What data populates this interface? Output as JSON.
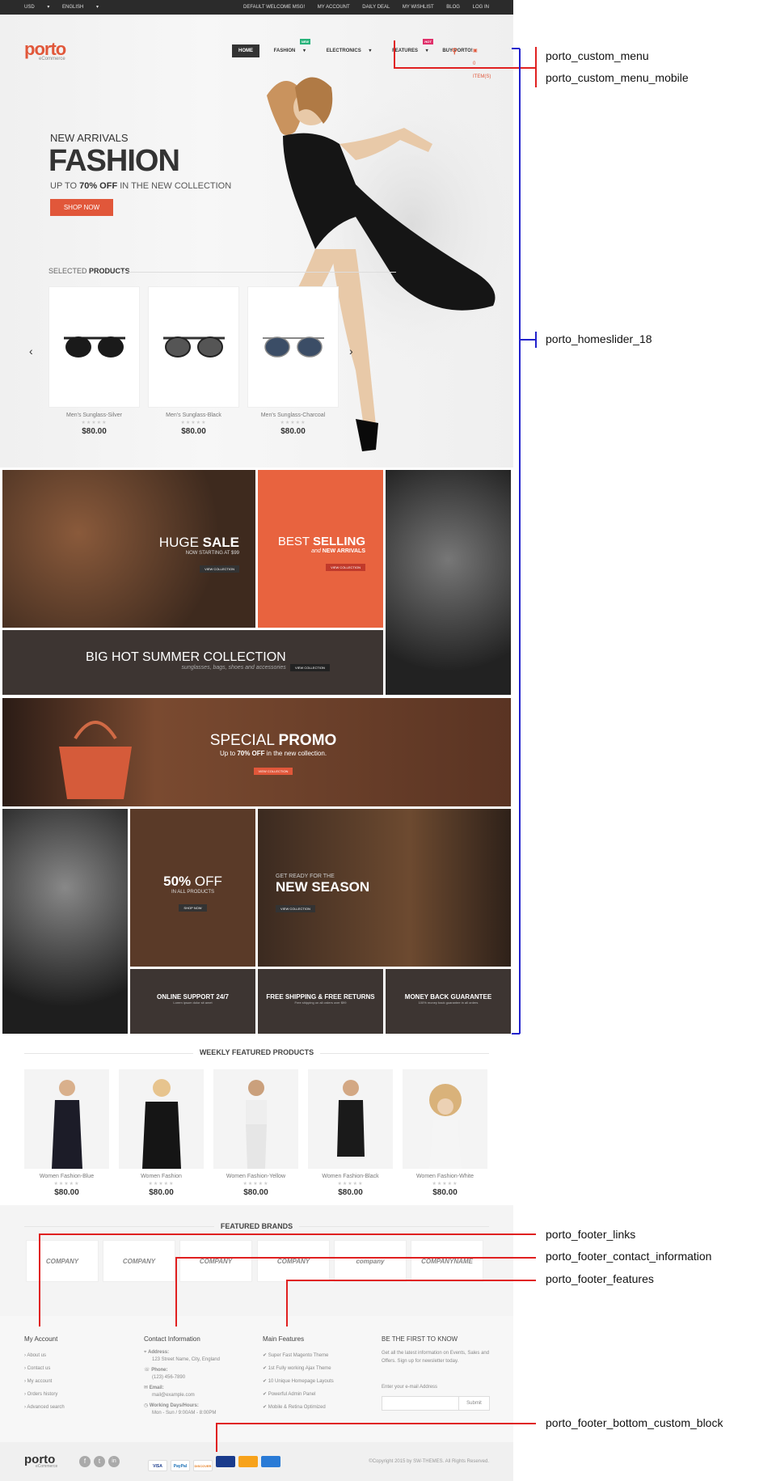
{
  "topbar": {
    "currency": "USD",
    "language": "ENGLISH",
    "links": [
      "DEFAULT WELCOME MSG!",
      "MY ACCOUNT",
      "DAILY DEAL",
      "MY WISHLIST",
      "BLOG",
      "LOG IN"
    ]
  },
  "header": {
    "logo": "porto",
    "logo_sub": "eCommerce",
    "nav": [
      "HOME",
      "FASHION",
      "ELECTRONICS",
      "FEATURES",
      "BUY PORTO!"
    ],
    "badge_new": "NEW",
    "badge_hot": "HOT",
    "cart": "0 ITEM(S)"
  },
  "hero": {
    "kicker": "NEW ARRIVALS",
    "title": "FASHION",
    "sub_pre": "UP TO",
    "sub_bold": "70% OFF",
    "sub_post": "IN THE NEW COLLECTION",
    "button": "SHOP NOW"
  },
  "selected": {
    "label_pre": "SELECTED",
    "label_bold": "PRODUCTS",
    "items": [
      {
        "name": "Men's Sunglass-Silver",
        "price": "$80.00"
      },
      {
        "name": "Men's Sunglass-Black",
        "price": "$80.00"
      },
      {
        "name": "Men's Sunglass-Charcoal",
        "price": "$80.00"
      }
    ]
  },
  "promos": {
    "huge_sale": {
      "title_a": "HUGE",
      "title_b": "SALE",
      "sub": "NOW STARTING AT $99",
      "btn": "VIEW COLLECTION"
    },
    "best": {
      "title_a": "BEST",
      "title_b": "SELLING",
      "sub_a": "and",
      "sub_b": "NEW ARRIVALS",
      "btn": "VIEW COLLECTION"
    },
    "summer": {
      "title": "BIG HOT SUMMER COLLECTION",
      "sub": "sunglasses, bags, shoes and accessories",
      "btn": "VIEW COLLECTION"
    },
    "special": {
      "title_a": "SPECIAL",
      "title_b": "PROMO",
      "sub_pre": "Up to",
      "sub_bold": "70% OFF",
      "sub_post": "in the new collection.",
      "btn": "VIEW COLLECTION"
    },
    "fifty": {
      "title_a": "50%",
      "title_b": "OFF",
      "sub": "IN ALL PRODUCTS",
      "btn": "SHOP NOW"
    },
    "season": {
      "kicker": "GET READY FOR THE",
      "title": "NEW SEASON",
      "btn": "VIEW COLLECTION"
    },
    "features": [
      {
        "title": "ONLINE SUPPORT 24/7",
        "sub": "Lorem ipsum dolor sit amet"
      },
      {
        "title": "FREE SHIPPING & FREE RETURNS",
        "sub": "Free shipping on all orders over $99"
      },
      {
        "title": "MONEY BACK GUARANTEE",
        "sub": "100% money back guarantee in all orders"
      }
    ]
  },
  "weekly": {
    "title": "WEEKLY FEATURED PRODUCTS",
    "items": [
      {
        "name": "Women Fashion-Blue",
        "price": "$80.00"
      },
      {
        "name": "Women Fashion",
        "price": "$80.00"
      },
      {
        "name": "Women Fashion-Yellow",
        "price": "$80.00"
      },
      {
        "name": "Women Fashion-Black",
        "price": "$80.00"
      },
      {
        "name": "Women Fashion-White",
        "price": "$80.00"
      }
    ]
  },
  "brands": {
    "title": "FEATURED BRANDS",
    "items": [
      "COMPANY",
      "COMPANY",
      "COMPANY",
      "COMPANY",
      "company",
      "COMPANYNAME"
    ]
  },
  "footer": {
    "account": {
      "title": "My Account",
      "links": [
        "About us",
        "Contact us",
        "My account",
        "Orders history",
        "Advanced search"
      ]
    },
    "contact": {
      "title": "Contact Information",
      "address_label": "Address:",
      "address": "123 Street Name, City, England",
      "phone_label": "Phone:",
      "phone": "(123) 456-7890",
      "email_label": "Email:",
      "email": "mail@example.com",
      "hours_label": "Working Days/Hours:",
      "hours": "Mon - Sun / 9:00AM - 8:00PM"
    },
    "features": {
      "title": "Main Features",
      "items": [
        "Super Fast Magento Theme",
        "1st Fully working Ajax Theme",
        "10 Unique Homepage Layouts",
        "Powerful Admin Panel",
        "Mobile & Retina Optimized"
      ]
    },
    "newsletter": {
      "title": "BE THE FIRST TO KNOW",
      "text": "Get all the latest information on Events, Sales and Offers. Sign up for newsletter today.",
      "label": "Enter your e-mail Address",
      "button": "Submit"
    },
    "copyright": "©Copyright 2015 by SW-THEMES. All Rights Reserved.",
    "payments": [
      "VISA",
      "PayPal",
      "DISCOVER",
      "",
      "",
      ""
    ]
  },
  "annotations": {
    "custom_menu": "porto_custom_menu",
    "custom_menu_mobile": "porto_custom_menu_mobile",
    "homeslider": "porto_homeslider_18",
    "footer_links": "porto_footer_links",
    "footer_contact": "porto_footer_contact_information",
    "footer_features": "porto_footer_features",
    "footer_bottom": "porto_footer_bottom_custom_block"
  },
  "colors": {
    "accent": "#e1573a",
    "annotation_red": "#e02020",
    "annotation_blue": "#2222cc",
    "dark": "#3a3330"
  }
}
